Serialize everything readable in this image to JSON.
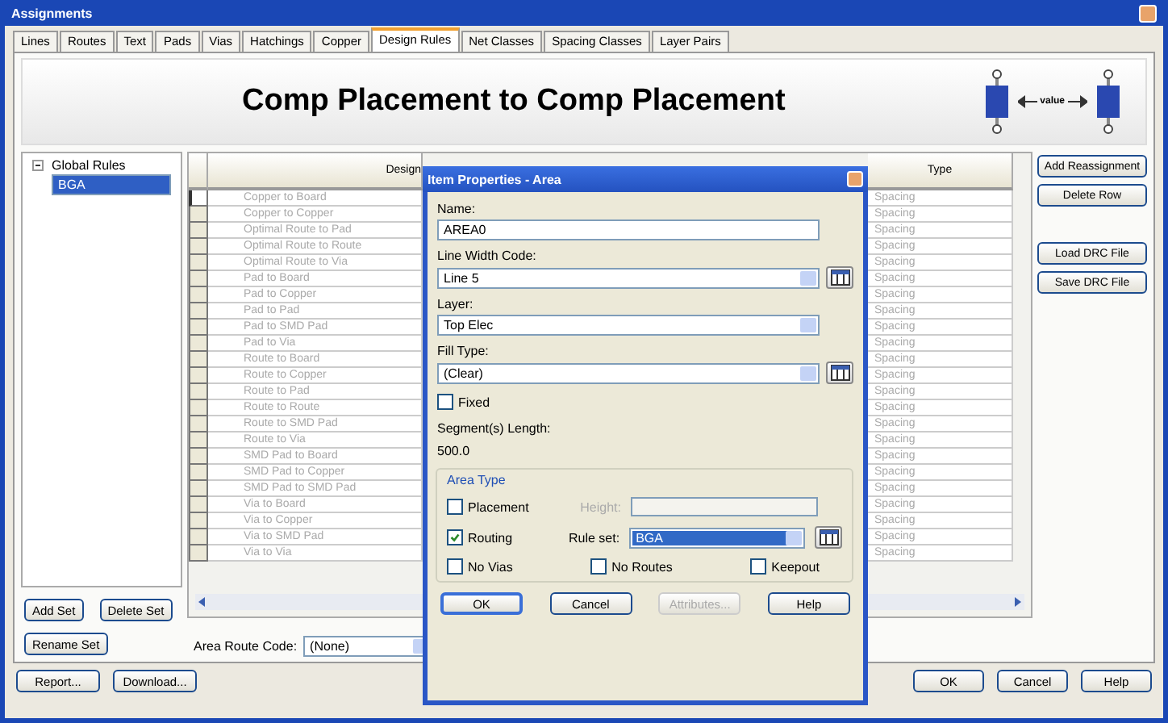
{
  "window": {
    "title": "Assignments"
  },
  "tabs": [
    {
      "label": "Lines",
      "selected": false
    },
    {
      "label": "Routes",
      "selected": false
    },
    {
      "label": "Text",
      "selected": false
    },
    {
      "label": "Pads",
      "selected": false
    },
    {
      "label": "Vias",
      "selected": false
    },
    {
      "label": "Hatchings",
      "selected": false
    },
    {
      "label": "Copper",
      "selected": false
    },
    {
      "label": "Design Rules",
      "selected": true
    },
    {
      "label": "Net Classes",
      "selected": false
    },
    {
      "label": "Spacing Classes",
      "selected": false
    },
    {
      "label": "Layer Pairs",
      "selected": false
    }
  ],
  "banner": {
    "title": "Comp Placement to Comp Placement",
    "diagram_label": "value"
  },
  "tree": [
    {
      "label": "Global Rules",
      "expanded": true,
      "selected": false,
      "children": [
        {
          "label": "BGA",
          "selected": true
        }
      ]
    }
  ],
  "set_buttons": [
    "Add Set",
    "Delete Set",
    "Rename Set"
  ],
  "table": {
    "columns": [
      "Design",
      "Type"
    ],
    "rows": [
      {
        "rule": "Copper to Board",
        "type": "Spacing",
        "current": true
      },
      {
        "rule": "Copper to Copper",
        "type": "Spacing",
        "current": false
      },
      {
        "rule": "Optimal Route to Pad",
        "type": "Spacing",
        "current": false
      },
      {
        "rule": "Optimal Route to Route",
        "type": "Spacing",
        "current": false
      },
      {
        "rule": "Optimal Route to Via",
        "type": "Spacing",
        "current": false
      },
      {
        "rule": "Pad to Board",
        "type": "Spacing",
        "current": false
      },
      {
        "rule": "Pad to Copper",
        "type": "Spacing",
        "current": false
      },
      {
        "rule": "Pad to Pad",
        "type": "Spacing",
        "current": false
      },
      {
        "rule": "Pad to SMD Pad",
        "type": "Spacing",
        "current": false
      },
      {
        "rule": "Pad to Via",
        "type": "Spacing",
        "current": false
      },
      {
        "rule": "Route to Board",
        "type": "Spacing",
        "current": false
      },
      {
        "rule": "Route to Copper",
        "type": "Spacing",
        "current": false
      },
      {
        "rule": "Route to Pad",
        "type": "Spacing",
        "current": false
      },
      {
        "rule": "Route to Route",
        "type": "Spacing",
        "current": false
      },
      {
        "rule": "Route to SMD Pad",
        "type": "Spacing",
        "current": false
      },
      {
        "rule": "Route to Via",
        "type": "Spacing",
        "current": false
      },
      {
        "rule": "SMD Pad to Board",
        "type": "Spacing",
        "current": false
      },
      {
        "rule": "SMD Pad to Copper",
        "type": "Spacing",
        "current": false
      },
      {
        "rule": "SMD Pad to SMD Pad",
        "type": "Spacing",
        "current": false
      },
      {
        "rule": "Via to Board",
        "type": "Spacing",
        "current": false
      },
      {
        "rule": "Via to Copper",
        "type": "Spacing",
        "current": false
      },
      {
        "rule": "Via to SMD Pad",
        "type": "Spacing",
        "current": false
      },
      {
        "rule": "Via to Via",
        "type": "Spacing",
        "current": false
      }
    ]
  },
  "area_route_code": {
    "label": "Area Route Code:",
    "value": "(None)"
  },
  "side_buttons": [
    "Add Reassignment",
    "Delete Row",
    "Load DRC File",
    "Save DRC File"
  ],
  "footer_left": [
    "Report...",
    "Download..."
  ],
  "footer_right": [
    "OK",
    "Cancel",
    "Help"
  ],
  "dialog": {
    "title": "Item Properties - Area",
    "fields": [
      {
        "kind": "text",
        "label": "Name:",
        "value": "AREA0",
        "picker": false
      },
      {
        "kind": "select",
        "label": "Line Width Code:",
        "value": "Line 5",
        "picker": true
      },
      {
        "kind": "select",
        "label": "Layer:",
        "value": "Top Elec",
        "picker": false
      },
      {
        "kind": "select",
        "label": "Fill Type:",
        "value": "(Clear)",
        "picker": true
      }
    ],
    "fixed": {
      "label": "Fixed",
      "checked": false
    },
    "segment_length": {
      "label": "Segment(s) Length:",
      "value": "500.0"
    },
    "area_type": {
      "title": "Area Type",
      "placement": {
        "label": "Placement",
        "checked": false
      },
      "height": {
        "label": "Height:",
        "disabled": true
      },
      "routing": {
        "label": "Routing",
        "checked": true
      },
      "rule_set": {
        "label": "Rule set:",
        "value": "BGA",
        "selected": true
      },
      "options": [
        {
          "label": "No Vias",
          "checked": false
        },
        {
          "label": "No Routes",
          "checked": false
        },
        {
          "label": "Keepout",
          "checked": false
        }
      ]
    },
    "buttons": [
      {
        "label": "OK",
        "default": true,
        "disabled": false
      },
      {
        "label": "Cancel",
        "default": false,
        "disabled": false
      },
      {
        "label": "Attributes...",
        "default": false,
        "disabled": true
      },
      {
        "label": "Help",
        "default": false,
        "disabled": false
      }
    ]
  }
}
